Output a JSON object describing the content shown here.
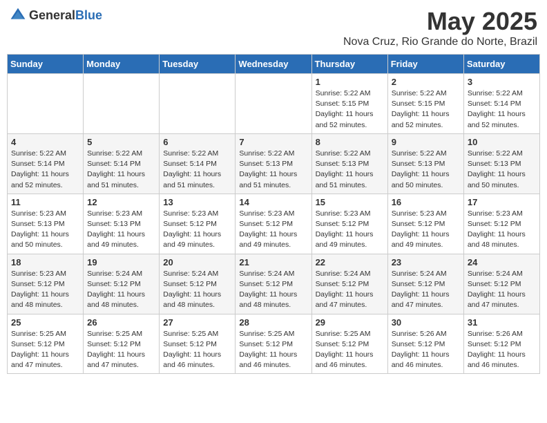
{
  "logo": {
    "general": "General",
    "blue": "Blue"
  },
  "title": "May 2025",
  "subtitle": "Nova Cruz, Rio Grande do Norte, Brazil",
  "headers": [
    "Sunday",
    "Monday",
    "Tuesday",
    "Wednesday",
    "Thursday",
    "Friday",
    "Saturday"
  ],
  "weeks": [
    [
      {
        "day": "",
        "info": ""
      },
      {
        "day": "",
        "info": ""
      },
      {
        "day": "",
        "info": ""
      },
      {
        "day": "",
        "info": ""
      },
      {
        "day": "1",
        "info": "Sunrise: 5:22 AM\nSunset: 5:15 PM\nDaylight: 11 hours\nand 52 minutes."
      },
      {
        "day": "2",
        "info": "Sunrise: 5:22 AM\nSunset: 5:15 PM\nDaylight: 11 hours\nand 52 minutes."
      },
      {
        "day": "3",
        "info": "Sunrise: 5:22 AM\nSunset: 5:14 PM\nDaylight: 11 hours\nand 52 minutes."
      }
    ],
    [
      {
        "day": "4",
        "info": "Sunrise: 5:22 AM\nSunset: 5:14 PM\nDaylight: 11 hours\nand 52 minutes."
      },
      {
        "day": "5",
        "info": "Sunrise: 5:22 AM\nSunset: 5:14 PM\nDaylight: 11 hours\nand 51 minutes."
      },
      {
        "day": "6",
        "info": "Sunrise: 5:22 AM\nSunset: 5:14 PM\nDaylight: 11 hours\nand 51 minutes."
      },
      {
        "day": "7",
        "info": "Sunrise: 5:22 AM\nSunset: 5:13 PM\nDaylight: 11 hours\nand 51 minutes."
      },
      {
        "day": "8",
        "info": "Sunrise: 5:22 AM\nSunset: 5:13 PM\nDaylight: 11 hours\nand 51 minutes."
      },
      {
        "day": "9",
        "info": "Sunrise: 5:22 AM\nSunset: 5:13 PM\nDaylight: 11 hours\nand 50 minutes."
      },
      {
        "day": "10",
        "info": "Sunrise: 5:22 AM\nSunset: 5:13 PM\nDaylight: 11 hours\nand 50 minutes."
      }
    ],
    [
      {
        "day": "11",
        "info": "Sunrise: 5:23 AM\nSunset: 5:13 PM\nDaylight: 11 hours\nand 50 minutes."
      },
      {
        "day": "12",
        "info": "Sunrise: 5:23 AM\nSunset: 5:13 PM\nDaylight: 11 hours\nand 49 minutes."
      },
      {
        "day": "13",
        "info": "Sunrise: 5:23 AM\nSunset: 5:12 PM\nDaylight: 11 hours\nand 49 minutes."
      },
      {
        "day": "14",
        "info": "Sunrise: 5:23 AM\nSunset: 5:12 PM\nDaylight: 11 hours\nand 49 minutes."
      },
      {
        "day": "15",
        "info": "Sunrise: 5:23 AM\nSunset: 5:12 PM\nDaylight: 11 hours\nand 49 minutes."
      },
      {
        "day": "16",
        "info": "Sunrise: 5:23 AM\nSunset: 5:12 PM\nDaylight: 11 hours\nand 49 minutes."
      },
      {
        "day": "17",
        "info": "Sunrise: 5:23 AM\nSunset: 5:12 PM\nDaylight: 11 hours\nand 48 minutes."
      }
    ],
    [
      {
        "day": "18",
        "info": "Sunrise: 5:23 AM\nSunset: 5:12 PM\nDaylight: 11 hours\nand 48 minutes."
      },
      {
        "day": "19",
        "info": "Sunrise: 5:24 AM\nSunset: 5:12 PM\nDaylight: 11 hours\nand 48 minutes."
      },
      {
        "day": "20",
        "info": "Sunrise: 5:24 AM\nSunset: 5:12 PM\nDaylight: 11 hours\nand 48 minutes."
      },
      {
        "day": "21",
        "info": "Sunrise: 5:24 AM\nSunset: 5:12 PM\nDaylight: 11 hours\nand 48 minutes."
      },
      {
        "day": "22",
        "info": "Sunrise: 5:24 AM\nSunset: 5:12 PM\nDaylight: 11 hours\nand 47 minutes."
      },
      {
        "day": "23",
        "info": "Sunrise: 5:24 AM\nSunset: 5:12 PM\nDaylight: 11 hours\nand 47 minutes."
      },
      {
        "day": "24",
        "info": "Sunrise: 5:24 AM\nSunset: 5:12 PM\nDaylight: 11 hours\nand 47 minutes."
      }
    ],
    [
      {
        "day": "25",
        "info": "Sunrise: 5:25 AM\nSunset: 5:12 PM\nDaylight: 11 hours\nand 47 minutes."
      },
      {
        "day": "26",
        "info": "Sunrise: 5:25 AM\nSunset: 5:12 PM\nDaylight: 11 hours\nand 47 minutes."
      },
      {
        "day": "27",
        "info": "Sunrise: 5:25 AM\nSunset: 5:12 PM\nDaylight: 11 hours\nand 46 minutes."
      },
      {
        "day": "28",
        "info": "Sunrise: 5:25 AM\nSunset: 5:12 PM\nDaylight: 11 hours\nand 46 minutes."
      },
      {
        "day": "29",
        "info": "Sunrise: 5:25 AM\nSunset: 5:12 PM\nDaylight: 11 hours\nand 46 minutes."
      },
      {
        "day": "30",
        "info": "Sunrise: 5:26 AM\nSunset: 5:12 PM\nDaylight: 11 hours\nand 46 minutes."
      },
      {
        "day": "31",
        "info": "Sunrise: 5:26 AM\nSunset: 5:12 PM\nDaylight: 11 hours\nand 46 minutes."
      }
    ]
  ]
}
